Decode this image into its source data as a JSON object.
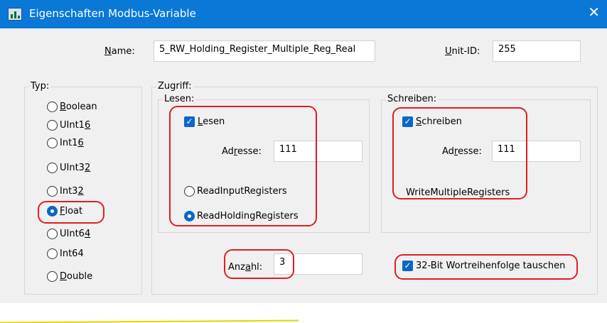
{
  "window": {
    "title": "Eigenschaften Modbus-Variable",
    "close_glyph": "✕",
    "app_icon": "modbus-app-icon"
  },
  "name": {
    "label_pre": "",
    "label_ul": "N",
    "label_post": "ame:",
    "value": "5_RW_Holding_Register_Multiple_Reg_Real"
  },
  "unit_id": {
    "label_pre": "",
    "label_ul": "U",
    "label_post": "nit-ID:",
    "value": "255"
  },
  "typ": {
    "title": "Typ:",
    "options": [
      {
        "pre": "",
        "ul": "B",
        "post": "oolean"
      },
      {
        "pre": "UInt1",
        "ul": "6",
        "post": ""
      },
      {
        "pre": "Int1",
        "ul": "6",
        "post": ""
      },
      {
        "pre": "UInt3",
        "ul": "2",
        "post": ""
      },
      {
        "pre": "Int3",
        "ul": "2",
        "post": ""
      },
      {
        "pre": "",
        "ul": "F",
        "post": "loat"
      },
      {
        "pre": "UInt6",
        "ul": "4",
        "post": ""
      },
      {
        "pre": "Int64",
        "ul": "",
        "post": ""
      },
      {
        "pre": "",
        "ul": "D",
        "post": "ouble"
      }
    ],
    "selected": "Float"
  },
  "zugriff": {
    "title": "Zugriff:",
    "lesen": {
      "title": "Lesen:",
      "check": {
        "pre": "",
        "ul": "L",
        "post": "esen",
        "checked": true
      },
      "adresse": {
        "pre": "Ad",
        "ul": "r",
        "post": "esse:",
        "value": "111"
      },
      "radio1": "ReadInputRegisters",
      "radio2": "ReadHoldingRegisters"
    },
    "schreiben": {
      "title": "Schreiben:",
      "check": {
        "pre": "",
        "ul": "S",
        "post": "chreiben",
        "checked": true
      },
      "adresse": {
        "pre": "Ad",
        "ul": "r",
        "post": "esse:",
        "value": "111"
      },
      "function": "WriteMultipleRegisters"
    },
    "anzahl": {
      "pre": "Anz",
      "ul": "a",
      "post": "hl:",
      "value": "3"
    },
    "swap": {
      "label": "32-Bit Wortreihenfolge tauschen",
      "checked": true
    }
  },
  "colors": {
    "titlebar": "#0a78d7",
    "client": "#f0f0f0",
    "highlight": "#e11d22",
    "accent": "#0a67c8"
  }
}
